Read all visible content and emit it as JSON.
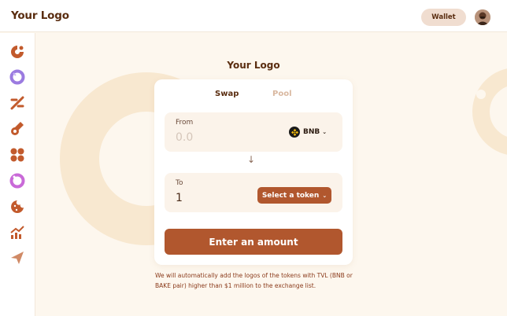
{
  "header": {
    "logo": "Your Logo",
    "wallet_label": "Wallet"
  },
  "sidebar": {
    "items": [
      {
        "icon": "donut-chart-icon"
      },
      {
        "icon": "donut-active-icon"
      },
      {
        "icon": "percent-icon"
      },
      {
        "icon": "rocket-icon"
      },
      {
        "icon": "grid-icon"
      },
      {
        "icon": "donut-pink-icon"
      },
      {
        "icon": "cookie-icon"
      },
      {
        "icon": "chart-up-icon"
      },
      {
        "icon": "send-icon"
      }
    ]
  },
  "main": {
    "title": "Your Logo",
    "tabs": [
      {
        "label": "Swap",
        "active": true
      },
      {
        "label": "Pool",
        "active": false
      }
    ],
    "from": {
      "label": "From",
      "value": "0.0",
      "token": "BNB"
    },
    "to": {
      "label": "To",
      "value": "1",
      "token_button": "Select a token"
    },
    "action_label": "Enter an amount",
    "note": "We will automatically add the logos of the tokens with TVL (BNB or BAKE pair) higher than $1 million to the exchange list."
  },
  "colors": {
    "accent": "#b1572e",
    "background": "#fdf7ee",
    "text": "#5a2d10"
  }
}
